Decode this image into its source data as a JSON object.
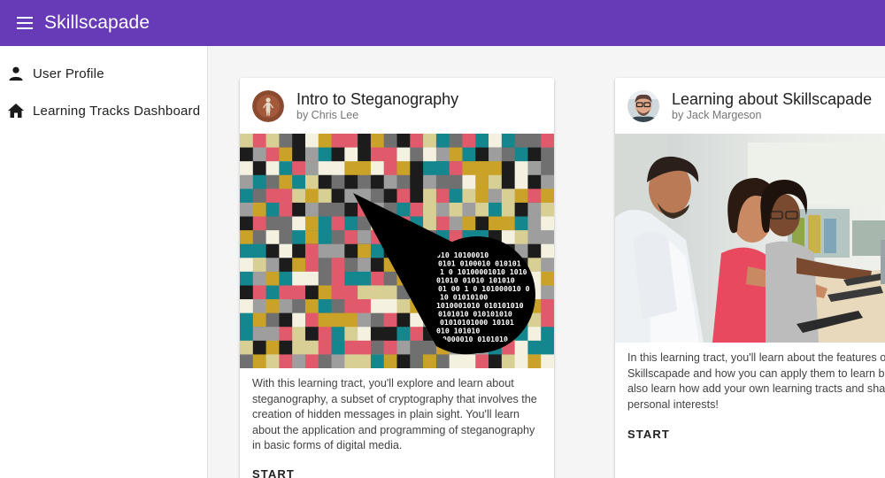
{
  "app": {
    "title": "Skillscapade"
  },
  "nav": {
    "items": [
      {
        "label": "User Profile",
        "icon": "person-icon"
      },
      {
        "label": "Learning Tracks Dashboard",
        "icon": "home-icon"
      }
    ]
  },
  "cards": [
    {
      "title": "Intro to Steganography",
      "author": "by Chris Lee",
      "description": "With this learning tract, you'll explore and learn about steganography, a subset of cryptography that involves the creation of hidden messages in plain sight. You'll learn about the application and programming of steganography in basic forms of digital media.",
      "action": "START",
      "binary_lines": [
        "010 10100010",
        "0101 0100010 010101",
        "1 0 10100001010 1010",
        "01010 01010 101010",
        "01 00 1 0 101000010 0",
        "10 01010100",
        "1010001010 010101010",
        "0101010 010101010",
        "01010101000 10101",
        "010 101010",
        "10000010 0101010"
      ]
    },
    {
      "title": "Learning about Skillscapade",
      "author": "by Jack Margeson",
      "description": "In this learning tract, you'll learn about the features of Skillscapade and how you can apply them to learn better. You'll also learn how add your own learning tracts and share your own personal interests!",
      "action": "START"
    }
  ],
  "colors": {
    "appbar": "#673ab7",
    "mosaic": [
      "#c9a227",
      "#e05a6b",
      "#13868e",
      "#1c1c1c",
      "#d8cf95",
      "#9e9e9e",
      "#f4f1e0",
      "#707070"
    ]
  }
}
